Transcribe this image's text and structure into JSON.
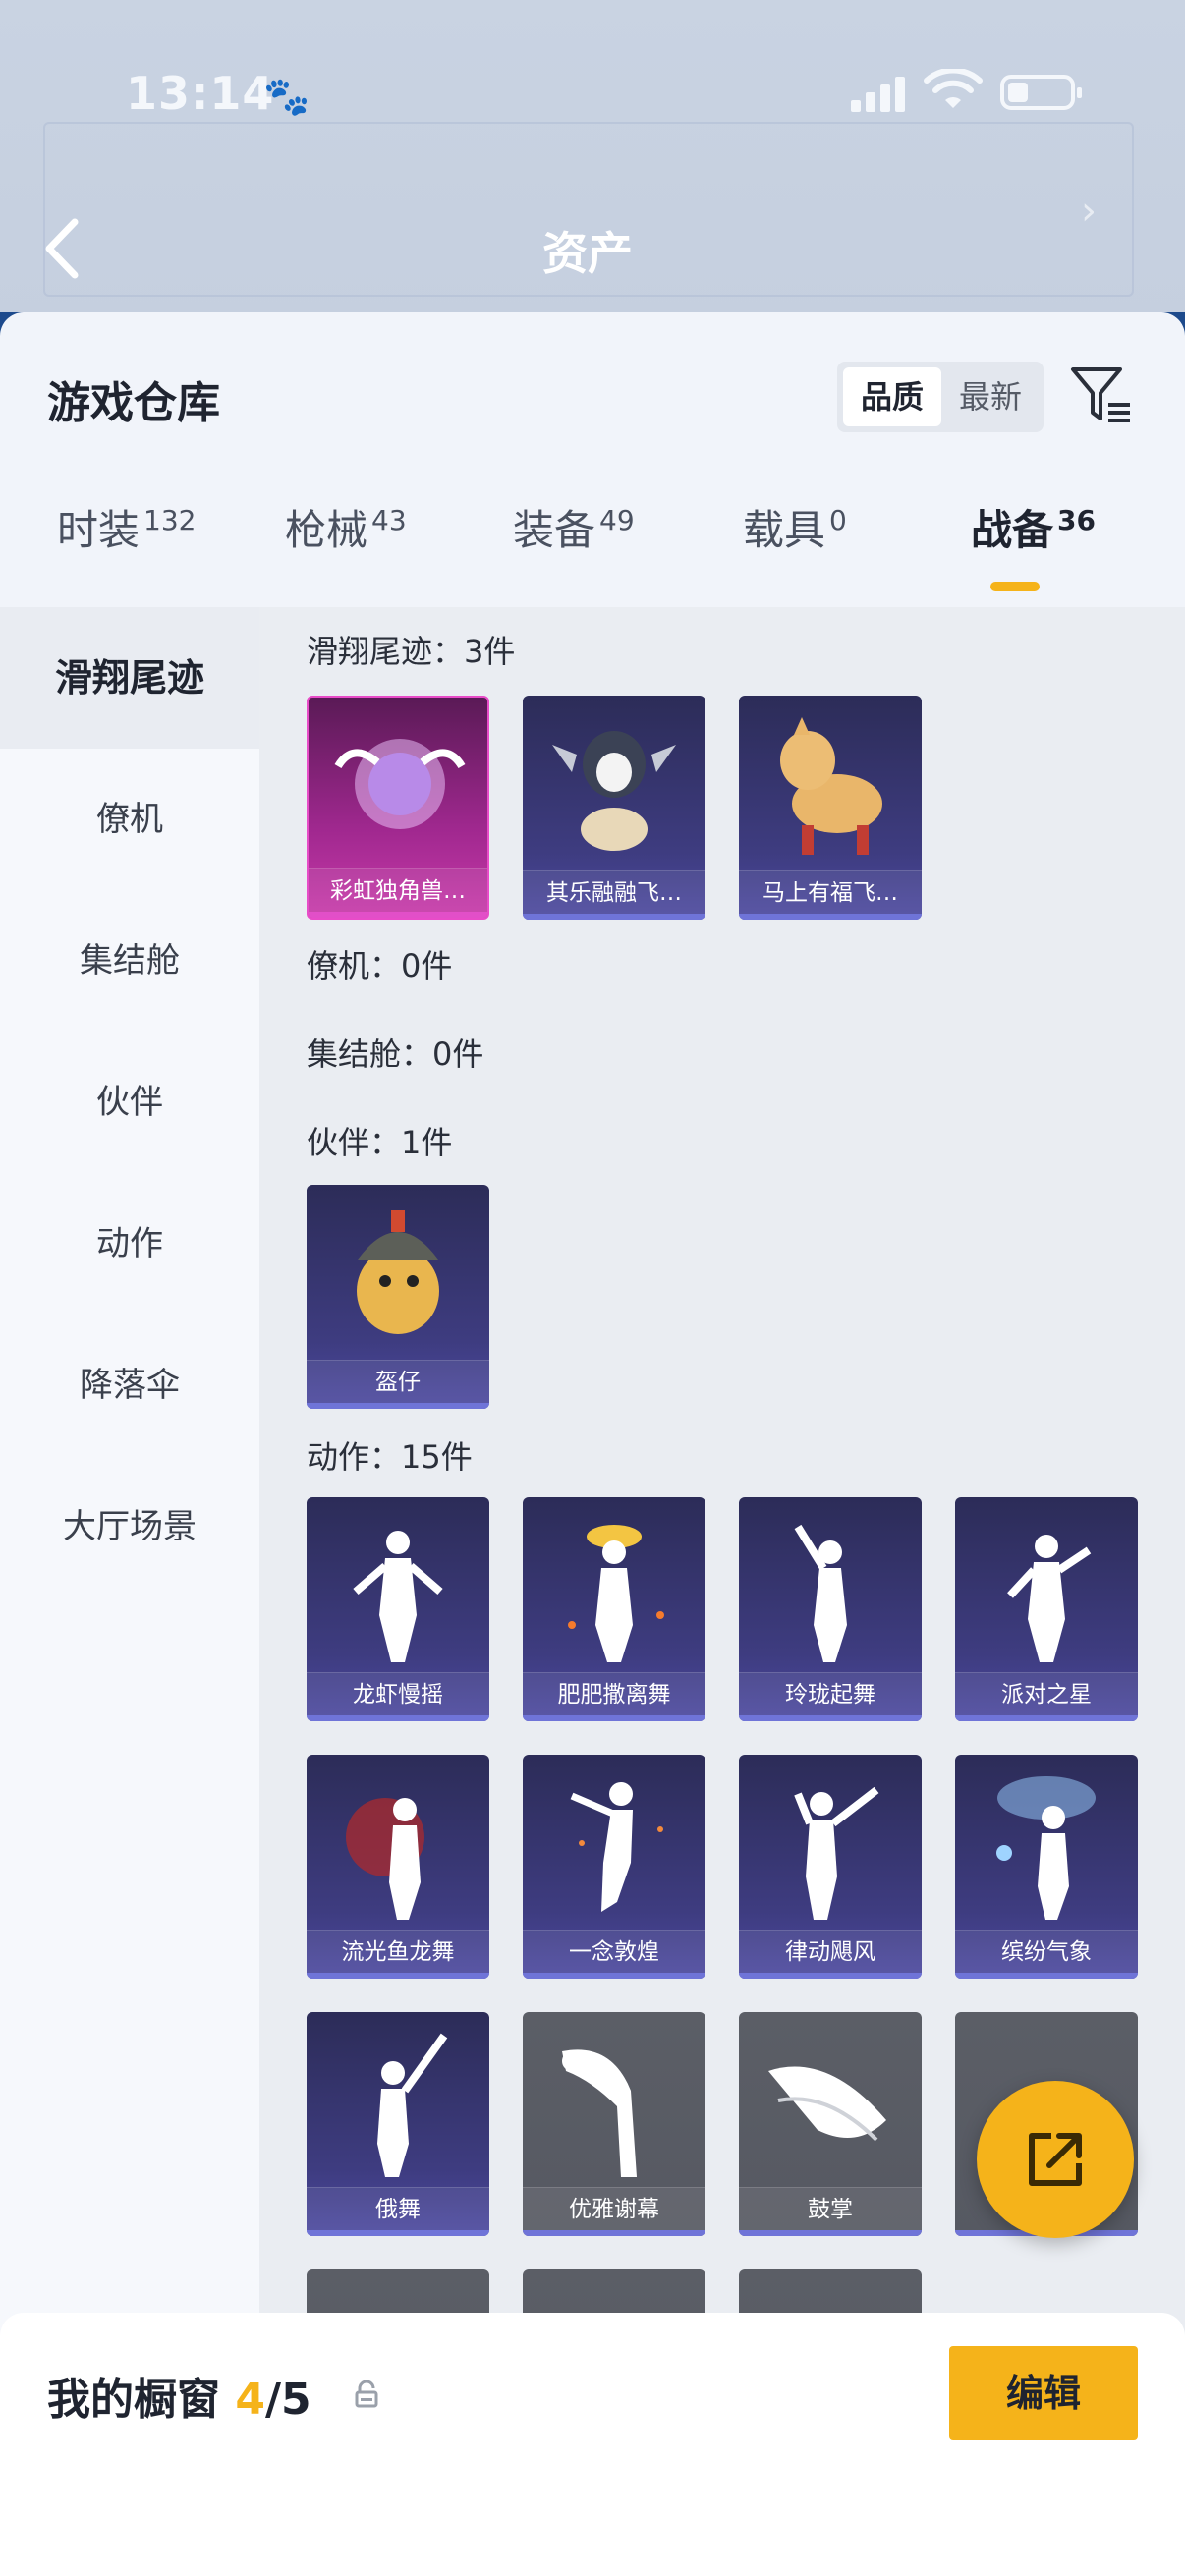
{
  "status": {
    "time": "13:14"
  },
  "nav": {
    "title": "资产"
  },
  "sheet": {
    "title": "游戏仓库",
    "sort": [
      "品质",
      "最新"
    ],
    "tabs": [
      {
        "label": "时装",
        "count": "132"
      },
      {
        "label": "枪械",
        "count": "43"
      },
      {
        "label": "装备",
        "count": "49"
      },
      {
        "label": "载具",
        "count": "0"
      },
      {
        "label": "战备",
        "count": "36"
      }
    ]
  },
  "sidebar": {
    "items": [
      "滑翔尾迹",
      "僚机",
      "集结舱",
      "伙伴",
      "动作",
      "降落伞",
      "大厅场景"
    ]
  },
  "sections": {
    "glide": "滑翔尾迹：3件",
    "wingman": "僚机：0件",
    "pod": "集结舱：0件",
    "partner": "伙伴：1件",
    "emote": "动作：15件"
  },
  "items": {
    "glide": [
      "彩虹独角兽…",
      "其乐融融飞…",
      "马上有福飞…"
    ],
    "partner": [
      "盔仔"
    ],
    "emote": [
      "龙虾慢摇",
      "肥肥撒离舞",
      "玲珑起舞",
      "派对之星",
      "流光鱼龙舞",
      "一念敦煌",
      "律动飓风",
      "缤纷气象",
      "俄舞",
      "优雅谢幕",
      "鼓掌"
    ]
  },
  "footer": {
    "title": "我的橱窗",
    "current": "4",
    "sep": "/",
    "total": "5",
    "edit": "编辑"
  },
  "colors": {
    "accent": "#f5b31a",
    "card_purple": "#3e3c80",
    "card_pink": "#c83aa9"
  }
}
